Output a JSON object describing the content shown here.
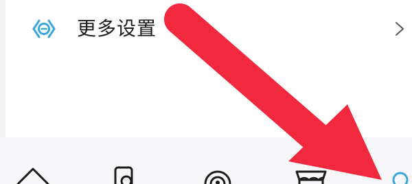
{
  "settings": {
    "more_settings_label": "更多设置",
    "icon": "hexagon-settings-icon",
    "chevron": "chevron-right-icon"
  },
  "bottom_nav": {
    "items": [
      {
        "icon": "home-icon"
      },
      {
        "icon": "device-icon"
      },
      {
        "icon": "broadcast-icon"
      },
      {
        "icon": "shop-icon"
      },
      {
        "icon": "profile-icon",
        "active": true
      }
    ]
  },
  "colors": {
    "accent": "#3aa6e0",
    "arrow": "#f0293e",
    "text": "#1b1b1b"
  }
}
